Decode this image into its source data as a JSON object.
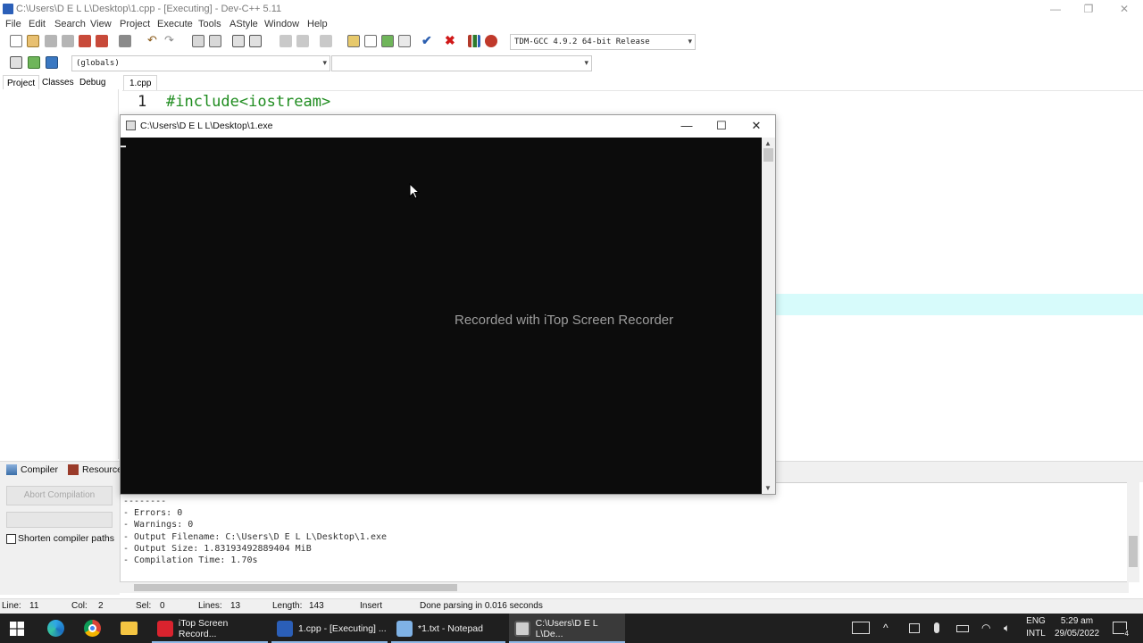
{
  "main_window": {
    "title": "C:\\Users\\D E L L\\Desktop\\1.cpp - [Executing] - Dev-C++ 5.11",
    "controls": {
      "minimize": "—",
      "restore": "❐",
      "close": "✕"
    }
  },
  "menu": [
    "File",
    "Edit",
    "Search",
    "View",
    "Project",
    "Execute",
    "Tools",
    "AStyle",
    "Window",
    "Help"
  ],
  "toolbar": {
    "compiler_select": "TDM-GCC 4.9.2 64-bit Release",
    "scope_select": "(globals)",
    "members_select": ""
  },
  "left_panel": {
    "tabs": [
      "Project",
      "Classes",
      "Debug"
    ]
  },
  "editor": {
    "tab": "1.cpp",
    "line_number": "1",
    "code": "#include<iostream>"
  },
  "bottom_panel": {
    "tabs": [
      "Compiler",
      "Resource"
    ],
    "abort_button": "Abort Compilation",
    "shorten_paths_label": "Shorten compiler paths",
    "log": [
      "--------",
      "- Errors: 0",
      "- Warnings: 0",
      "- Output Filename: C:\\Users\\D E L L\\Desktop\\1.exe",
      "- Output Size: 1.83193492889404 MiB",
      "- Compilation Time: 1.70s"
    ]
  },
  "status_bar": {
    "line_label": "Line:",
    "line": "11",
    "col_label": "Col:",
    "col": "2",
    "sel_label": "Sel:",
    "sel": "0",
    "lines_label": "Lines:",
    "lines": "13",
    "length_label": "Length:",
    "length": "143",
    "mode": "Insert",
    "message": "Done parsing in 0.016 seconds"
  },
  "console": {
    "title": "C:\\Users\\D E L L\\Desktop\\1.exe",
    "controls": {
      "minimize": "—",
      "maximize": "☐",
      "close": "✕"
    },
    "watermark": "Recorded with iTop Screen Recorder"
  },
  "taskbar": {
    "apps": [
      {
        "label": "iTop Screen Record...",
        "color": "#d9232e"
      },
      {
        "label": "1.cpp - [Executing] ...",
        "color": "#2b5fb8"
      },
      {
        "label": "*1.txt - Notepad",
        "color": "#7fb2e5"
      },
      {
        "label": "C:\\Users\\D E L L\\De...",
        "color": "#cfcfcf"
      }
    ],
    "language": "ENG",
    "layout": "INTL",
    "time": "5:29 am",
    "date": "29/05/2022",
    "notification_count": "4"
  }
}
